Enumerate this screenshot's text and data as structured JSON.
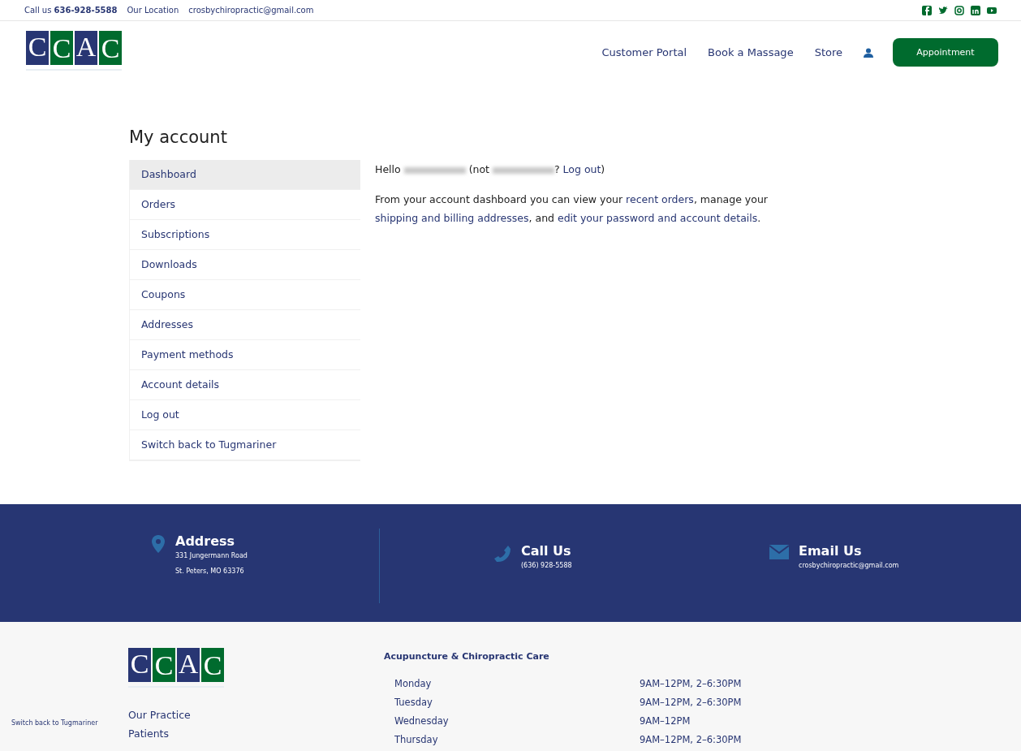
{
  "topbar": {
    "call_label": "Call us",
    "phone": "636-928-5588",
    "location": "Our Location",
    "email": "crosbychiropractic@gmail.com"
  },
  "logo": {
    "letters": [
      "C",
      "C",
      "A",
      "C"
    ]
  },
  "nav": {
    "links": [
      "Customer Portal",
      "Book a Massage",
      "Store"
    ],
    "button": "Appointment"
  },
  "page_title": "My account",
  "sidebar": {
    "items": [
      {
        "label": "Dashboard",
        "selected": true
      },
      {
        "label": "Orders",
        "selected": false
      },
      {
        "label": "Subscriptions",
        "selected": false
      },
      {
        "label": "Downloads",
        "selected": false
      },
      {
        "label": "Coupons",
        "selected": false
      },
      {
        "label": "Addresses",
        "selected": false
      },
      {
        "label": "Payment methods",
        "selected": false
      },
      {
        "label": "Account details",
        "selected": false
      },
      {
        "label": "Log out",
        "selected": false
      },
      {
        "label": "Switch back to Tugmariner",
        "selected": false
      }
    ]
  },
  "greeting": {
    "hello": "Hello",
    "not": "(not",
    "question": "?",
    "logout": "Log out",
    "close": ")"
  },
  "intro": [
    {
      "kind": "text",
      "text": "From your account dashboard you can view your "
    },
    {
      "kind": "link",
      "text": "recent orders"
    },
    {
      "kind": "text",
      "text": ", manage your "
    },
    {
      "kind": "link",
      "text": "shipping and billing addresses"
    },
    {
      "kind": "text",
      "text": ", and "
    },
    {
      "kind": "link",
      "text": "edit your password and account details"
    },
    {
      "kind": "text",
      "text": "."
    }
  ],
  "contact": [
    {
      "kind": "address",
      "title": "Address",
      "lines": [
        "331 Jungermann Road",
        "St. Peters, MO 63376"
      ]
    },
    {
      "kind": "phone",
      "title": "Call Us",
      "lines": [
        "(636) 928-5588"
      ]
    },
    {
      "kind": "email",
      "title": "Email Us",
      "lines": [
        "crosbychiropractic@gmail.com"
      ]
    }
  ],
  "footer": {
    "logo_letters": [
      "C",
      "C",
      "A",
      "C"
    ],
    "switch_back": "Switch back to Tugmariner",
    "links": [
      "Our Practice",
      "Patients"
    ],
    "hours_title": "Acupuncture & Chiropractic Care",
    "hours": [
      {
        "day": "Monday",
        "time": "9AM–12PM, 2–6:30PM"
      },
      {
        "day": "Tuesday",
        "time": "9AM–12PM, 2–6:30PM"
      },
      {
        "day": "Wednesday",
        "time": "9AM–12PM"
      },
      {
        "day": "Thursday",
        "time": "9AM–12PM, 2–6:30PM"
      }
    ]
  }
}
